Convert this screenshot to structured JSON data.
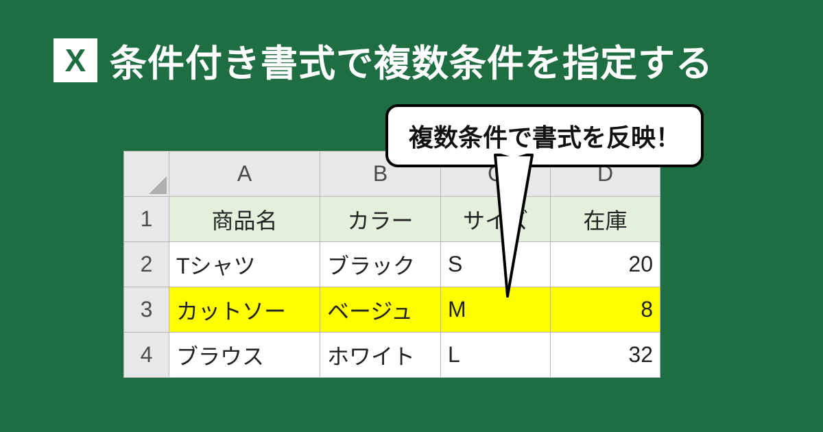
{
  "header": {
    "icon_letter": "X",
    "title": "条件付き書式で複数条件を指定する"
  },
  "callout": {
    "text": "複数条件で書式を反映！"
  },
  "sheet": {
    "columns": [
      "A",
      "B",
      "C",
      "D"
    ],
    "label_row": {
      "num": "1",
      "cells": [
        "商品名",
        "カラー",
        "サイズ",
        "在庫"
      ]
    },
    "rows": [
      {
        "num": "2",
        "cells": [
          "Tシャツ",
          "ブラック",
          "S",
          "20"
        ],
        "highlight": false
      },
      {
        "num": "3",
        "cells": [
          "カットソー",
          "ベージュ",
          "M",
          "8"
        ],
        "highlight": true
      },
      {
        "num": "4",
        "cells": [
          "ブラウス",
          "ホワイト",
          "L",
          "32"
        ],
        "highlight": false
      }
    ]
  },
  "colors": {
    "bg": "#1e6e42",
    "highlight": "#ffff00",
    "label_row": "#e4efdc"
  }
}
